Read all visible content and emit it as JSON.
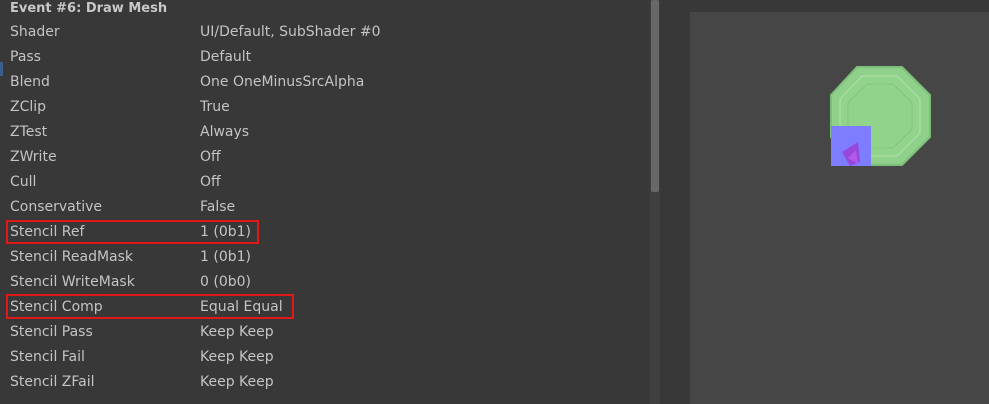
{
  "event": {
    "title": "Event #6: Draw Mesh"
  },
  "properties": [
    {
      "key": "Shader",
      "value": "UI/Default, SubShader #0"
    },
    {
      "key": "Pass",
      "value": "Default"
    },
    {
      "key": "Blend",
      "value": "One OneMinusSrcAlpha"
    },
    {
      "key": "ZClip",
      "value": "True"
    },
    {
      "key": "ZTest",
      "value": "Always"
    },
    {
      "key": "ZWrite",
      "value": "Off"
    },
    {
      "key": "Cull",
      "value": "Off"
    },
    {
      "key": "Conservative",
      "value": "False"
    },
    {
      "key": "Stencil Ref",
      "value": "1 (0b1)"
    },
    {
      "key": "Stencil ReadMask",
      "value": "1 (0b1)"
    },
    {
      "key": "Stencil WriteMask",
      "value": "0 (0b0)"
    },
    {
      "key": "Stencil Comp",
      "value": "Equal Equal"
    },
    {
      "key": "Stencil Pass",
      "value": "Keep Keep"
    },
    {
      "key": "Stencil Fail",
      "value": "Keep Keep"
    },
    {
      "key": "Stencil ZFail",
      "value": "Keep Keep"
    }
  ],
  "colors": {
    "highlight": "#e01818",
    "mesh_green": "#8fd08a",
    "mesh_blue": "#7e7cff"
  }
}
